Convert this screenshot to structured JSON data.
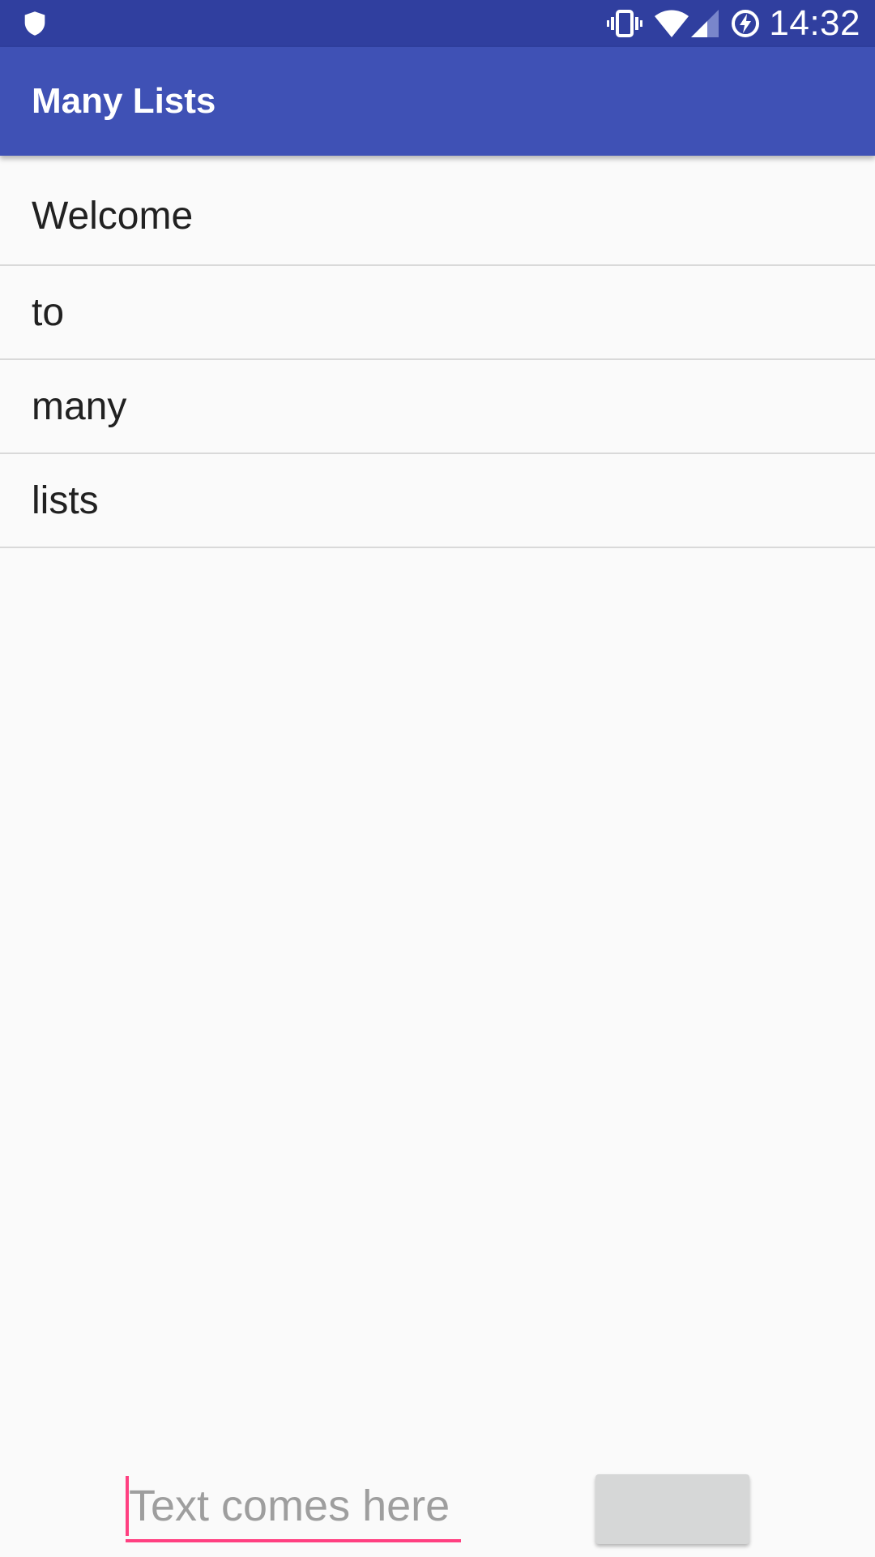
{
  "status_bar": {
    "time": "14:32",
    "left_icon": "shield-icon",
    "icons": [
      "vibrate-icon",
      "wifi-icon",
      "signal-icon",
      "battery-charging-icon"
    ],
    "bg_color": "#303f9f"
  },
  "app_bar": {
    "title": "Many Lists",
    "bg_color": "#3f51b5"
  },
  "list": {
    "items": [
      {
        "label": "Welcome"
      },
      {
        "label": "to"
      },
      {
        "label": "many"
      },
      {
        "label": "lists"
      }
    ]
  },
  "input": {
    "value": "",
    "placeholder": "Text comes here",
    "accent_color": "#ff4081"
  },
  "button": {
    "label": ""
  }
}
